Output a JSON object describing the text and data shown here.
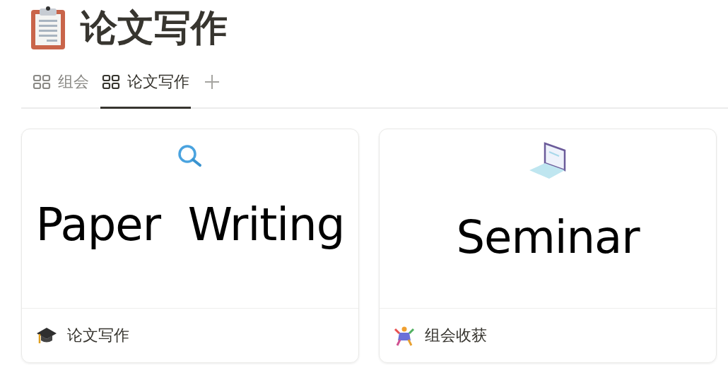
{
  "page": {
    "title": "论文写作"
  },
  "tabs": [
    {
      "label": "组会",
      "selected": false
    },
    {
      "label": "论文写作",
      "selected": true
    }
  ],
  "cards": [
    {
      "kind": "writing",
      "cover_text": "Paper  Writing",
      "name": "论文写作"
    },
    {
      "kind": "seminar",
      "cover_text": "Seminar",
      "name": "组会收获"
    }
  ]
}
